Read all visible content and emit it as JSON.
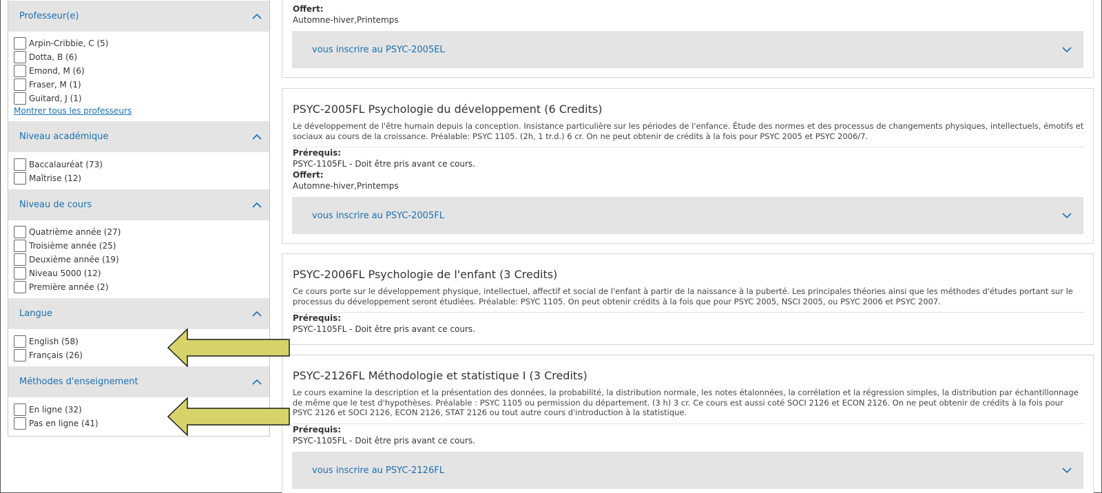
{
  "sidebar": {
    "facets": [
      {
        "title": "Professeur(e)",
        "options": [
          "Arpin-Cribbie, C (5)",
          "Dotta, B (6)",
          "Emond, M (6)",
          "Fraser, M (1)",
          "Guitard, J (1)"
        ],
        "show_all": "Montrer tous les professeurs"
      },
      {
        "title": "Niveau académique",
        "options": [
          "Baccalauréat (73)",
          "Maîtrise (12)"
        ]
      },
      {
        "title": "Niveau de cours",
        "options": [
          "Quatrième année (27)",
          "Troisième année (25)",
          "Deuxième année (19)",
          "Niveau 5000 (12)",
          "Première année (2)"
        ]
      },
      {
        "title": "Langue",
        "options": [
          "English (58)",
          "Français (26)"
        ]
      },
      {
        "title": "Méthodes d'enseignement",
        "options": [
          "En ligne (32)",
          "Pas en ligne (41)"
        ]
      }
    ]
  },
  "courses": [
    {
      "offert_label": "Offert:",
      "offert_value": "Automne-hiver,Printemps",
      "enroll_label": "vous inscrire au PSYC-2005EL"
    },
    {
      "title": "PSYC-2005FL Psychologie du développement (6 Credits)",
      "desc": "Le développement de l'être humain depuis la conception. Insistance particulière sur les périodes de l'enfance. Étude des normes et des processus de changements physiques, intellectuels, émotifs et sociaux au cours de la croissance. Préalable: PSYC 1105. (2h, 1 tr.d.) 6 cr. On ne peut obtenir de crédits à la fois pour PSYC 2005 et PSYC 2006/7.",
      "prereq_label": "Prérequis:",
      "prereq_value": "PSYC-1105FL - Doit être pris avant ce cours.",
      "offert_label": "Offert:",
      "offert_value": "Automne-hiver,Printemps",
      "enroll_label": "vous inscrire au PSYC-2005FL"
    },
    {
      "title": "PSYC-2006FL Psychologie de l'enfant (3 Credits)",
      "desc": "Ce cours porte sur le développement physique, intellectuel, affectif et social de l'enfant à partir de la naissance à la puberté. Les principales théories ainsi que les méthodes d'études portant sur le processus du développement seront étudiées. Préalable: PSYC 1105. On peut obtenir crédits à la fois que pour PSYC 2005, NSCI 2005, ou PSYC 2006 et PSYC 2007.",
      "prereq_label": "Prérequis:",
      "prereq_value": "PSYC-1105FL - Doit être pris avant ce cours."
    },
    {
      "title": "PSYC-2126FL Méthodologie et statistique I (3 Credits)",
      "desc": "Le cours examine la description et la présentation des données, la probabilité, la distribution normale, les notes étalonnées, la corrélation et la régression simples, la distribution par échantillonnage de même que le test d'hypothèses. Préalable : PSYC 1105 ou permission du département. (3 h) 3 cr. Ce cours est aussi coté SOCI 2126 et ECON 2126. On ne peut obtenir de crédits à la fois pour PSYC 2126 et SOCI 2126, ECON 2126, STAT 2126 ou tout autre cours d'introduction à la statistique.",
      "prereq_label": "Prérequis:",
      "prereq_value": "PSYC-1105FL - Doit être pris avant ce cours.",
      "enroll_label": "vous inscrire au PSYC-2126FL"
    }
  ],
  "colors": {
    "link": "#1a6fb5",
    "header_bg": "#e4e4e4",
    "arrow_fill": "#d6d36a"
  },
  "icons": {
    "collapse": "chevron-up-icon",
    "expand": "chevron-down-icon",
    "annotation": "arrow-left-icon"
  }
}
